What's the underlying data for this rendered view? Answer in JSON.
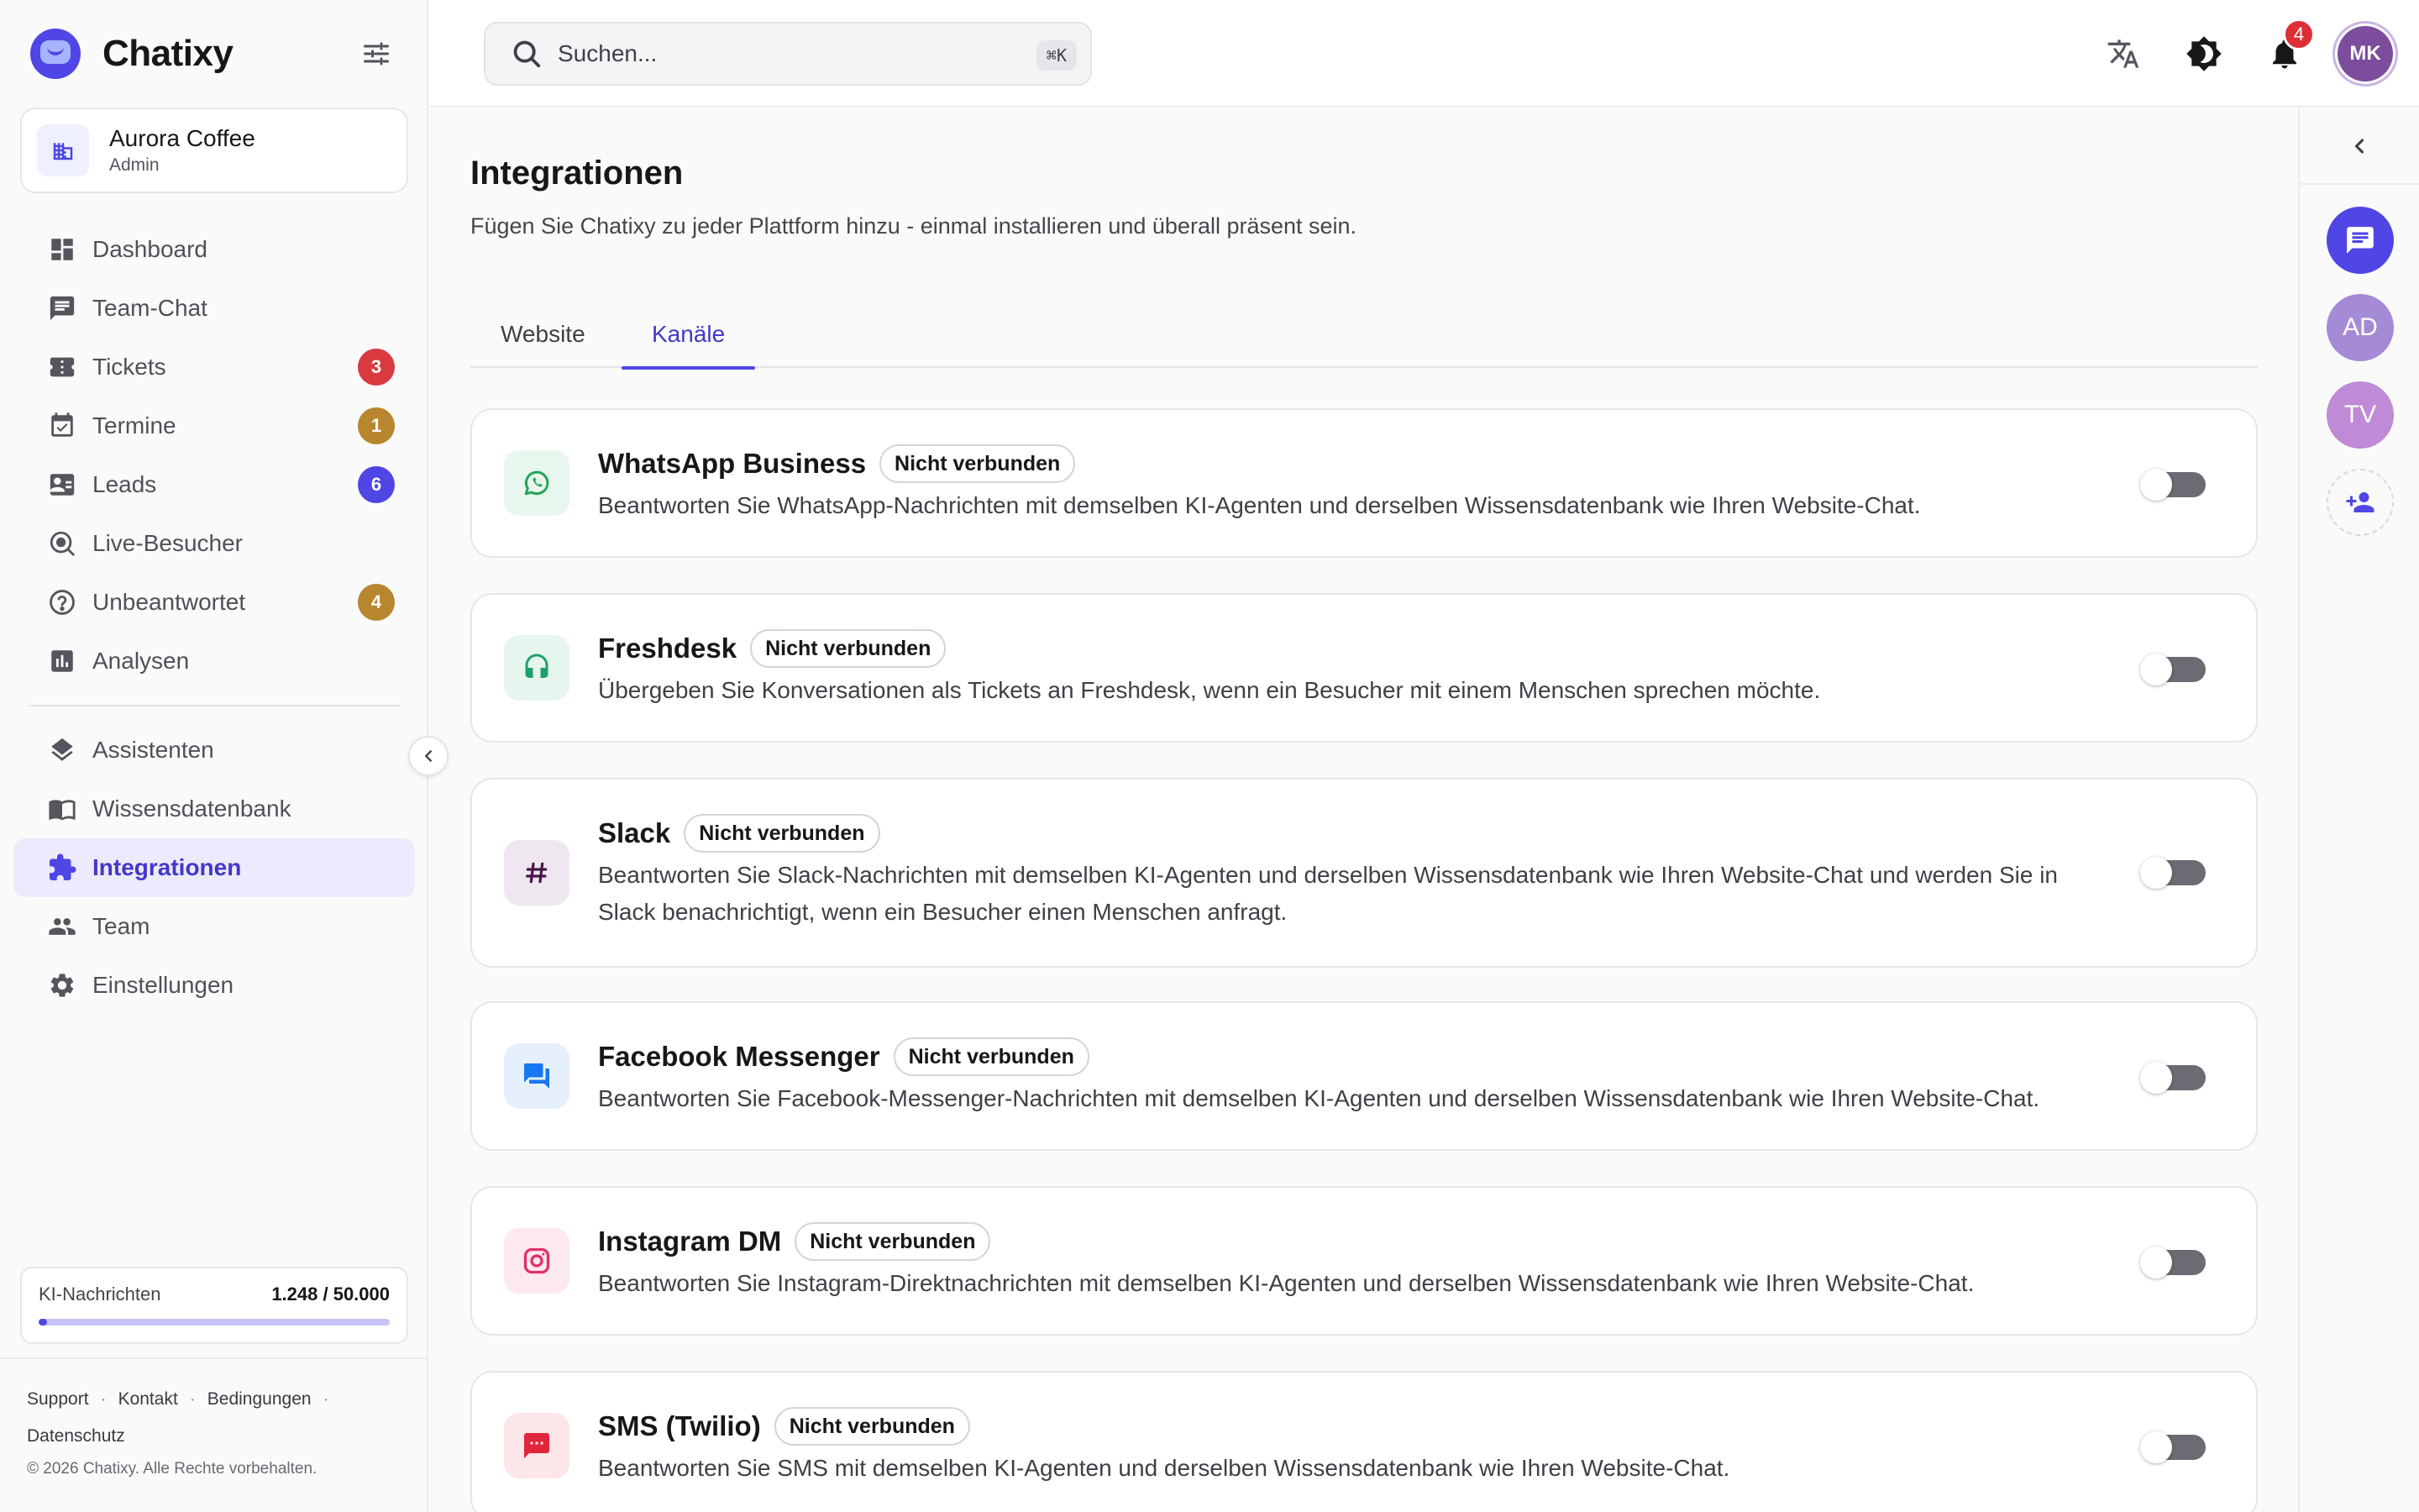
{
  "app": {
    "name": "Chatixy"
  },
  "org": {
    "name": "Aurora Coffee",
    "role": "Admin"
  },
  "nav": {
    "items": [
      {
        "label": "Dashboard",
        "icon": "dashboard-icon"
      },
      {
        "label": "Team-Chat",
        "icon": "chat-icon"
      },
      {
        "label": "Tickets",
        "icon": "ticket-icon",
        "badge": "3",
        "badge_color": "#d93a40"
      },
      {
        "label": "Termine",
        "icon": "calendar-icon",
        "badge": "1",
        "badge_color": "#b8862e"
      },
      {
        "label": "Leads",
        "icon": "contact-card-icon",
        "badge": "6",
        "badge_color": "#4f46e5"
      },
      {
        "label": "Live-Besucher",
        "icon": "live-search-icon"
      },
      {
        "label": "Unbeantwortet",
        "icon": "question-icon",
        "badge": "4",
        "badge_color": "#b8862e"
      },
      {
        "label": "Analysen",
        "icon": "analytics-icon"
      }
    ],
    "items2": [
      {
        "label": "Assistenten",
        "icon": "layers-icon"
      },
      {
        "label": "Wissensdatenbank",
        "icon": "book-icon"
      },
      {
        "label": "Integrationen",
        "icon": "puzzle-icon",
        "active": true
      },
      {
        "label": "Team",
        "icon": "team-icon"
      },
      {
        "label": "Einstellungen",
        "icon": "gear-icon"
      }
    ]
  },
  "usage": {
    "label": "KI-Nachrichten",
    "value": "1.248 / 50.000",
    "fraction": 0.025
  },
  "footer": {
    "links": [
      "Support",
      "Kontakt",
      "Bedingungen",
      "Datenschutz"
    ],
    "copyright": "© 2026 Chatixy. Alle Rechte vorbehalten."
  },
  "search": {
    "placeholder": "Suchen...",
    "shortcut": "⌘K"
  },
  "topbar": {
    "notifications": "4",
    "user_initials": "MK"
  },
  "page": {
    "title": "Integrationen",
    "subtitle": "Fügen Sie Chatixy zu jeder Plattform hinzu - einmal installieren und überall präsent sein."
  },
  "tabs": [
    {
      "label": "Website",
      "active": false
    },
    {
      "label": "Kanäle",
      "active": true
    }
  ],
  "channels": [
    {
      "name": "WhatsApp Business",
      "status": "Nicht verbunden",
      "icon": "whatsapp-icon",
      "icon_color": "#25a35a",
      "icon_bg": "#e7f7ee",
      "enabled": false,
      "description": "Beantworten Sie WhatsApp-Nachrichten mit demselben KI-Agenten und derselben Wissensdatenbank wie Ihren Website-Chat."
    },
    {
      "name": "Freshdesk",
      "status": "Nicht verbunden",
      "icon": "headset-icon",
      "icon_color": "#1fa06a",
      "icon_bg": "#e6f6ee",
      "enabled": false,
      "description": "Übergeben Sie Konversationen als Tickets an Freshdesk, wenn ein Besucher mit einem Menschen sprechen möchte."
    },
    {
      "name": "Slack",
      "status": "Nicht verbunden",
      "icon": "hash-icon",
      "icon_color": "#4a154b",
      "icon_bg": "#efe7ef",
      "enabled": false,
      "description": "Beantworten Sie Slack-Nachrichten mit demselben KI-Agenten und derselben Wissensdatenbank wie Ihren Website-Chat und werden Sie in Slack benachrichtigt, wenn ein Besucher einen Menschen anfragt."
    },
    {
      "name": "Facebook Messenger",
      "status": "Nicht verbunden",
      "icon": "messenger-icon",
      "icon_color": "#1877f2",
      "icon_bg": "#e6f0fd",
      "enabled": false,
      "description": "Beantworten Sie Facebook-Messenger-Nachrichten mit demselben KI-Agenten und derselben Wissensdatenbank wie Ihren Website-Chat."
    },
    {
      "name": "Instagram DM",
      "status": "Nicht verbunden",
      "icon": "instagram-icon",
      "icon_color": "#e1306c",
      "icon_bg": "#fde8ef",
      "enabled": false,
      "description": "Beantworten Sie Instagram-Direktnachrichten mit demselben KI-Agenten und derselben Wissensdatenbank wie Ihren Website-Chat."
    },
    {
      "name": "SMS (Twilio)",
      "status": "Nicht verbunden",
      "icon": "sms-icon",
      "icon_color": "#e0263a",
      "icon_bg": "#fde6e8",
      "enabled": false,
      "description": "Beantworten Sie SMS mit demselben KI-Agenten und derselben Wissensdatenbank wie Ihren Website-Chat."
    }
  ],
  "rail": {
    "users": [
      {
        "initials": "AD",
        "color": "#a58bd6"
      },
      {
        "initials": "TV",
        "color": "#c08ad6"
      }
    ]
  },
  "colors": {
    "accent": "#4f46e5",
    "accent_text": "#4338ca"
  }
}
